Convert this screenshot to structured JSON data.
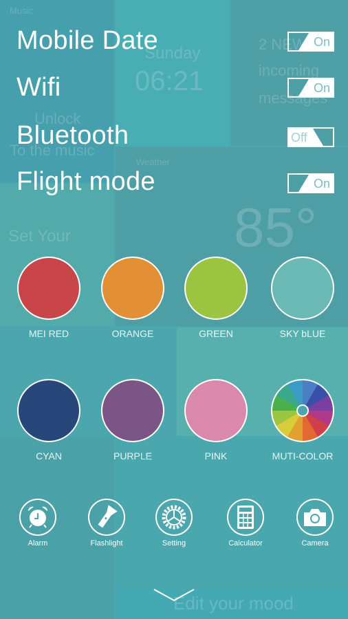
{
  "background": {
    "music_label": "Music",
    "day": "Sunday",
    "time": "06:21",
    "new_msgs": "2 NEW",
    "incoming": "incoming",
    "messages": "messages",
    "unlock": "Unlock",
    "to_music": "To the music",
    "weather_label": "Weather",
    "temperature": "85°",
    "set_your": "Set Your",
    "edit_mood": "Edit your mood"
  },
  "toggles": [
    {
      "label": "Mobile Date",
      "state": "On"
    },
    {
      "label": "Wifi",
      "state": "On"
    },
    {
      "label": "Bluetooth",
      "state": "Off"
    },
    {
      "label": "Flight mode",
      "state": "On"
    }
  ],
  "colors": [
    {
      "label": "MEI RED",
      "hex": "#c8464a"
    },
    {
      "label": "ORANGE",
      "hex": "#e28f36"
    },
    {
      "label": "GREEN",
      "hex": "#9bc440"
    },
    {
      "label": "SKY bLUE",
      "hex": "#6bb9b5"
    },
    {
      "label": "CYAN",
      "hex": "#27467a"
    },
    {
      "label": "PURPLE",
      "hex": "#7b5585"
    },
    {
      "label": "PINK",
      "hex": "#db88ad"
    },
    {
      "label": "MUTI-COLOR",
      "hex": "multi"
    }
  ],
  "tools": [
    {
      "label": "Alarm",
      "icon": "alarm-clock-icon"
    },
    {
      "label": "Flashlight",
      "icon": "flashlight-icon"
    },
    {
      "label": "Setting",
      "icon": "gear-icon"
    },
    {
      "label": "Calculator",
      "icon": "calculator-icon"
    },
    {
      "label": "Camera",
      "icon": "camera-icon"
    }
  ]
}
